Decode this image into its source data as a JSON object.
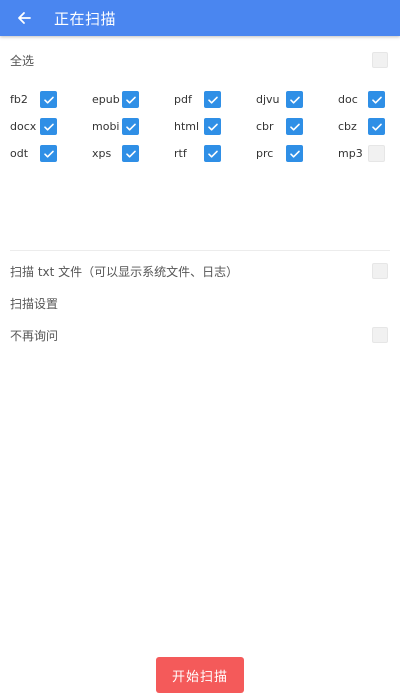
{
  "header": {
    "title": "正在扫描",
    "bg_color": "#4a86f0"
  },
  "select_all": {
    "label": "全选",
    "checked": false
  },
  "formats": [
    {
      "name": "fb2",
      "checked": true
    },
    {
      "name": "epub",
      "checked": true
    },
    {
      "name": "pdf",
      "checked": true
    },
    {
      "name": "djvu",
      "checked": true
    },
    {
      "name": "doc",
      "checked": true
    },
    {
      "name": "docx",
      "checked": true
    },
    {
      "name": "mobi",
      "checked": true
    },
    {
      "name": "html",
      "checked": true
    },
    {
      "name": "cbr",
      "checked": true
    },
    {
      "name": "cbz",
      "checked": true
    },
    {
      "name": "odt",
      "checked": true
    },
    {
      "name": "xps",
      "checked": true
    },
    {
      "name": "rtf",
      "checked": true
    },
    {
      "name": "prc",
      "checked": true
    },
    {
      "name": "mp3",
      "checked": false
    }
  ],
  "options": {
    "scan_txt_label": "扫描 txt 文件（可以显示系统文件、日志）",
    "scan_txt_checked": false,
    "settings_label": "扫描设置",
    "no_ask_label": "不再询问",
    "no_ask_checked": false
  },
  "start_button": {
    "label": "开始扫描",
    "color": "#f45a5a"
  },
  "checkbox_color": "#2f8fe6"
}
